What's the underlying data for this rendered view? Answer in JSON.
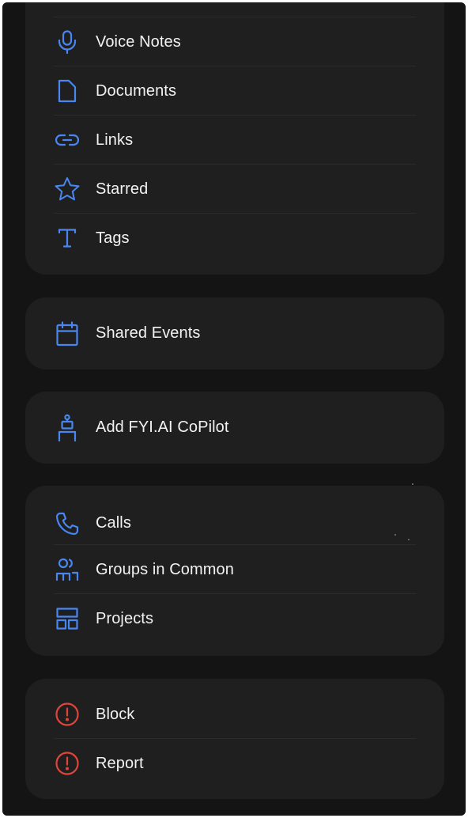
{
  "colors": {
    "background": "#141414",
    "card": "#1f1f1f",
    "accent": "#4a86f0",
    "danger": "#e0443a",
    "text": "#f2f2f2"
  },
  "media_card": {
    "items": [
      {
        "label": "Voice Notes",
        "icon": "microphone-icon"
      },
      {
        "label": "Documents",
        "icon": "document-icon"
      },
      {
        "label": "Links",
        "icon": "link-icon"
      },
      {
        "label": "Starred",
        "icon": "star-icon"
      },
      {
        "label": "Tags",
        "icon": "tag-t-icon"
      }
    ]
  },
  "events_card": {
    "items": [
      {
        "label": "Shared Events",
        "icon": "calendar-icon"
      }
    ]
  },
  "copilot_card": {
    "items": [
      {
        "label": "Add FYI.AI CoPilot",
        "icon": "robot-icon"
      }
    ]
  },
  "activity_card": {
    "items": [
      {
        "label": "Calls",
        "icon": "phone-icon"
      },
      {
        "label": "Groups in Common",
        "icon": "group-icon"
      },
      {
        "label": "Projects",
        "icon": "projects-icon"
      }
    ]
  },
  "danger_card": {
    "items": [
      {
        "label": "Block",
        "icon": "alert-circle-icon"
      },
      {
        "label": "Report",
        "icon": "alert-circle-icon"
      }
    ]
  }
}
